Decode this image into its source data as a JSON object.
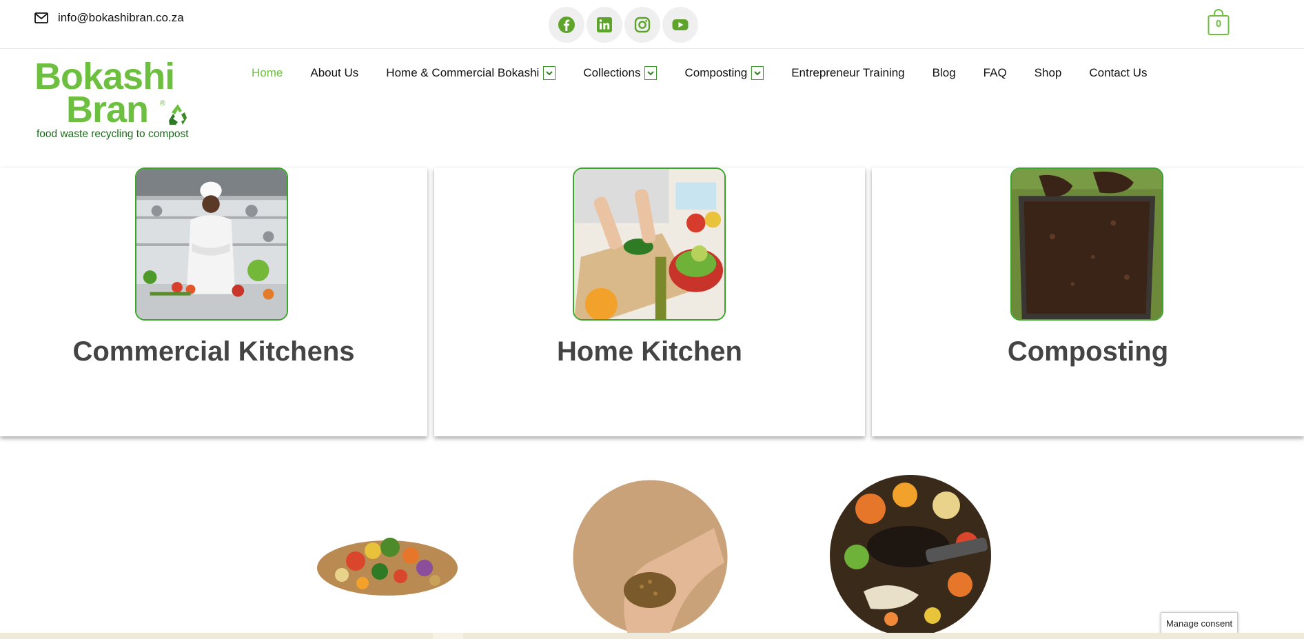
{
  "topbar": {
    "email": "info@bokashibran.co.za",
    "email_icon": "envelope-icon",
    "socials": [
      {
        "name": "facebook-icon"
      },
      {
        "name": "linkedin-icon"
      },
      {
        "name": "instagram-icon"
      },
      {
        "name": "youtube-icon"
      }
    ],
    "cart_count": "0",
    "accent": "#5ea32a"
  },
  "logo": {
    "line1": "Bokashi",
    "line2": "Bran",
    "reg": "®",
    "tagline": "food waste recycling to compost",
    "color": "#6cbf3f"
  },
  "nav": {
    "items": [
      {
        "label": "Home",
        "active": true,
        "dropdown": false
      },
      {
        "label": "About Us",
        "active": false,
        "dropdown": false
      },
      {
        "label": "Home & Commercial Bokashi",
        "active": false,
        "dropdown": true
      },
      {
        "label": "Collections",
        "active": false,
        "dropdown": true
      },
      {
        "label": "Composting",
        "active": false,
        "dropdown": true
      },
      {
        "label": "Entrepreneur Training",
        "active": false,
        "dropdown": false
      },
      {
        "label": "Blog",
        "active": false,
        "dropdown": false
      },
      {
        "label": "FAQ",
        "active": false,
        "dropdown": false
      },
      {
        "label": "Shop",
        "active": false,
        "dropdown": false
      },
      {
        "label": "Contact Us",
        "active": false,
        "dropdown": false
      }
    ]
  },
  "cards": [
    {
      "title": "Commercial Kitchens"
    },
    {
      "title": "Home Kitchen"
    },
    {
      "title": "Composting"
    }
  ],
  "consent": {
    "label": "Manage consent"
  }
}
